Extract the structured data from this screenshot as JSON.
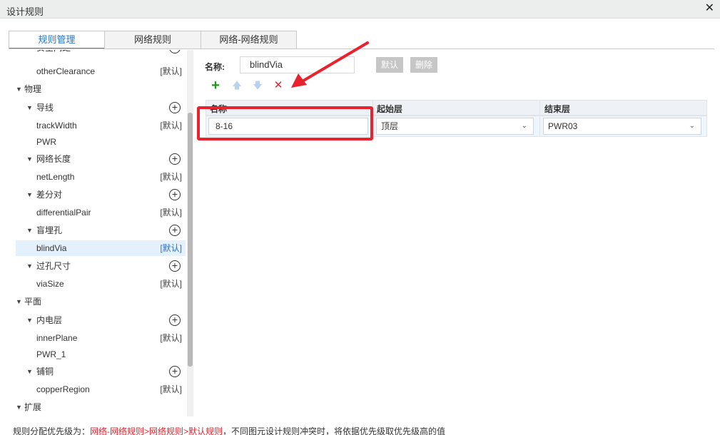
{
  "window": {
    "title": "设计规则",
    "close_glyph": "✕"
  },
  "tabs": [
    {
      "label": "规则管理",
      "active": true
    },
    {
      "label": "网络规则",
      "active": false
    },
    {
      "label": "网络-网络规则",
      "active": false
    }
  ],
  "tree": {
    "default_label": "[默认]",
    "partial_top_label": "安全间距",
    "items": {
      "otherClearance": "otherClearance",
      "physics": "物理",
      "wire": "导线",
      "trackWidth": "trackWidth",
      "pwr": "PWR",
      "netLengthGroup": "网络长度",
      "netLength": "netLength",
      "diffPairGroup": "差分对",
      "differentialPair": "differentialPair",
      "blindViaGroup": "盲埋孔",
      "blindVia": "blindVia",
      "viaSizeGroup": "过孔尺寸",
      "viaSize": "viaSize",
      "plane": "平面",
      "innerPlaneGroup": "内电层",
      "innerPlane": "innerPlane",
      "pwr1": "PWR_1",
      "copperGroup": "铺铜",
      "copperRegion": "copperRegion",
      "extend": "扩展"
    }
  },
  "form": {
    "name_label": "名称:",
    "name_value": "blindVia",
    "default_button": "默认",
    "delete_button": "删除"
  },
  "toolbar": {
    "add": "+",
    "up": "🡅",
    "down": "🡇",
    "remove": "✕"
  },
  "grid": {
    "columns": [
      "名称",
      "起始层",
      "结束层"
    ],
    "rows": [
      {
        "name": "8-16",
        "start_layer": "顶层",
        "end_layer": "PWR03"
      }
    ]
  },
  "footer": {
    "prefix": "规则分配优先级为：",
    "priority": "网络-网络规则>网络规则>默认规则",
    "suffix": "，不同图元设计规则冲突时，将依据优先级取优先级高的值"
  },
  "colors": {
    "accent": "#2a74c4",
    "annotation": "#e8232e",
    "selection": "#e4f0fc"
  }
}
